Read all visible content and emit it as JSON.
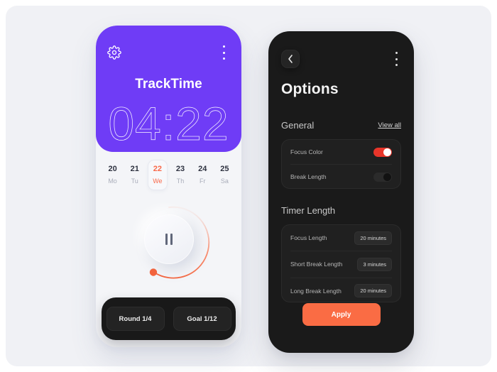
{
  "theme": {
    "page_bg": "#f0f1f5",
    "purple": "#6f3cf6",
    "orange": "#fa6c44",
    "toggle_on": "#e8352a",
    "dark_panel": "#1a1a1a"
  },
  "timer_phone": {
    "gear_icon": "gear-icon",
    "menu_icon": "more-vertical-icon",
    "app_title": "TrackTime",
    "time_display": "04:22",
    "dates": [
      {
        "num": "20",
        "day": "Mo",
        "active": false
      },
      {
        "num": "21",
        "day": "Tu",
        "active": false
      },
      {
        "num": "22",
        "day": "We",
        "active": true
      },
      {
        "num": "23",
        "day": "Th",
        "active": false
      },
      {
        "num": "24",
        "day": "Fr",
        "active": false
      },
      {
        "num": "25",
        "day": "Sa",
        "active": false
      }
    ],
    "transport": {
      "icon": "pause-icon",
      "progress_percent": 55
    },
    "stats": [
      {
        "label": "Round 1/4"
      },
      {
        "label": "Goal 1/12"
      }
    ]
  },
  "options_phone": {
    "back_icon": "chevron-left-icon",
    "menu_icon": "more-vertical-icon",
    "title": "Options",
    "general": {
      "heading": "General",
      "view_all_label": "View all",
      "rows": [
        {
          "label": "Focus Color",
          "state": "on"
        },
        {
          "label": "Break Length",
          "state": "off"
        }
      ]
    },
    "timer_length": {
      "heading": "Timer Length",
      "rows": [
        {
          "label": "Focus Length",
          "value": "20 minutes"
        },
        {
          "label": "Short Break Length",
          "value": "3 minutes"
        },
        {
          "label": "Long Break Length",
          "value": "20 minutes"
        }
      ]
    },
    "apply_label": "Apply"
  }
}
